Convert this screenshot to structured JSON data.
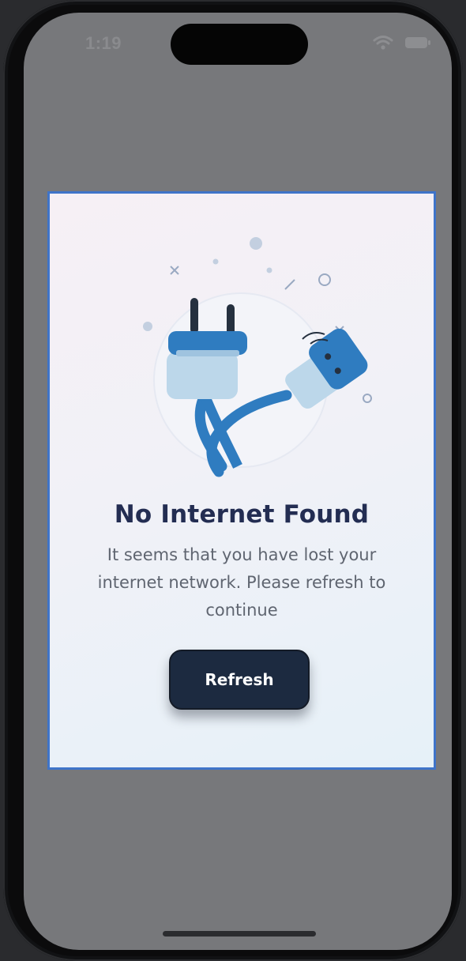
{
  "status_bar": {
    "time": "1:19",
    "wifi_icon": "wifi-icon",
    "battery_icon": "battery-icon"
  },
  "dialog": {
    "illustration_icon": "unplugged-cable-icon",
    "title": "No Internet Found",
    "message": "It seems that you have lost your internet network. Please refresh to continue",
    "refresh_label": "Refresh"
  },
  "colors": {
    "accent_border": "#3f74c9",
    "title": "#232d52",
    "button_bg": "#1c2a40",
    "plug_blue": "#2f7cc0",
    "plug_light": "#bcd7ea",
    "overlay": "#77787b"
  }
}
